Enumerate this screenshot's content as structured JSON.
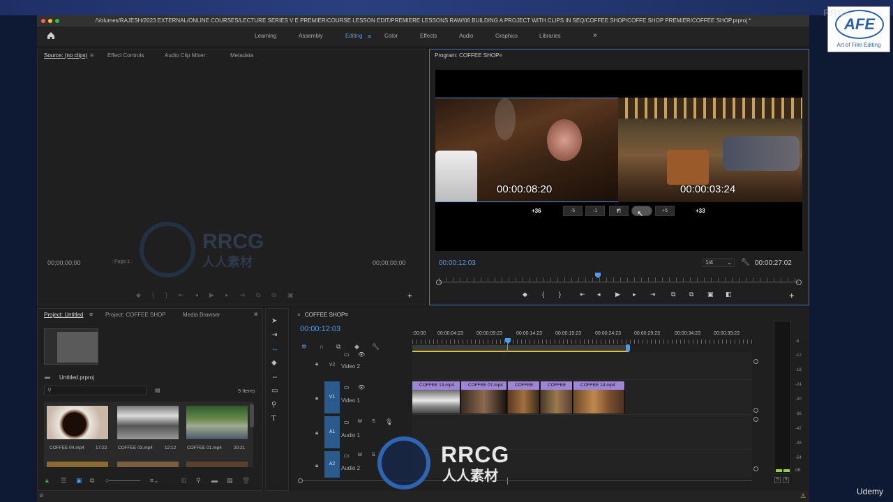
{
  "window": {
    "title": "/Volumes/RAJESH/2023 EXTERNAL/ONLINE COURSES/LECTURE SERIES V E PREMIER/COURSE LESSON EDIT/PREMIERE LESSONS RAW/06 BUILDING A PROJECT WITH CLIPS IN SEQ/COFFEE SHOP/COFFE SHOP PREMIER/COFFEE SHOP.prproj *"
  },
  "workspaces": {
    "items": [
      "Learning",
      "Assembly",
      "Editing",
      "Color",
      "Effects",
      "Audio",
      "Graphics",
      "Libraries"
    ],
    "active": "Editing",
    "more": "»"
  },
  "source_panel": {
    "tabs": [
      "Source: (no clips)",
      "Effect Controls",
      "Audio Clip Mixer:",
      "Metadata"
    ],
    "timecode_left": "00;00;00;00",
    "timecode_right": "00;00;00;00",
    "page": "Page 1"
  },
  "program_panel": {
    "title": "Program: COFFEE SHOP",
    "current_time": "00:00:12:03",
    "duration": "00:00:27:02",
    "resolution": "1/4",
    "trim_left_tc": "00:00:08:20",
    "trim_right_tc": "00:00:03:24",
    "trim_left_offset": "+36",
    "trim_right_offset": "+33",
    "trim_buttons": [
      "-5",
      "-1",
      "",
      "",
      "+5"
    ]
  },
  "project_panel": {
    "tabs": [
      "Project: Untitled",
      "Project: COFFEE SHOP",
      "Media Browser"
    ],
    "project_file": "Untitled.prproj",
    "item_count": "9 Items",
    "items": [
      {
        "name": "COFFEE 04.mp4",
        "duration": "17:22"
      },
      {
        "name": "COFFEE 03.mp4",
        "duration": "12:12"
      },
      {
        "name": "COFFEE 01.mp4",
        "duration": "20:21"
      }
    ]
  },
  "timeline": {
    "sequence": "COFFEE SHOP",
    "current_time": "00:00:12:03",
    "ruler": [
      ":00:00",
      "00:00:04:23",
      "00:00:09:23",
      "00:00:14:23",
      "00:00:19:23",
      "00:00:24:23",
      "00:00:29:23",
      "00:00:34:23",
      "00:00:39:23"
    ],
    "tracks": [
      {
        "id": "V2",
        "name": "Video 2"
      },
      {
        "id": "V1",
        "name": "Video 1"
      },
      {
        "id": "A1",
        "name": "Audio 1"
      },
      {
        "id": "A2",
        "name": "Audio 2"
      }
    ],
    "clips": [
      "COFFEE 13.mp4",
      "COFFEE 07.mp4",
      "COFFEE",
      "COFFEE",
      "COFFEE 14.mp4"
    ]
  },
  "meter": {
    "scale": [
      "-6",
      "-12",
      "-18",
      "-24",
      "-30",
      "-36",
      "-42",
      "-48",
      "-54",
      "dB"
    ],
    "solo": [
      "S",
      "S"
    ]
  },
  "branding": {
    "logo_text": "Art of Film Editing",
    "watermark_top": "RRCG",
    "watermark_sub": "人人素材",
    "udemy": "Udemy"
  },
  "colors": {
    "accent": "#4a9cf0",
    "clip": "#9d86d6",
    "track_btn": "#2a5b8c"
  }
}
